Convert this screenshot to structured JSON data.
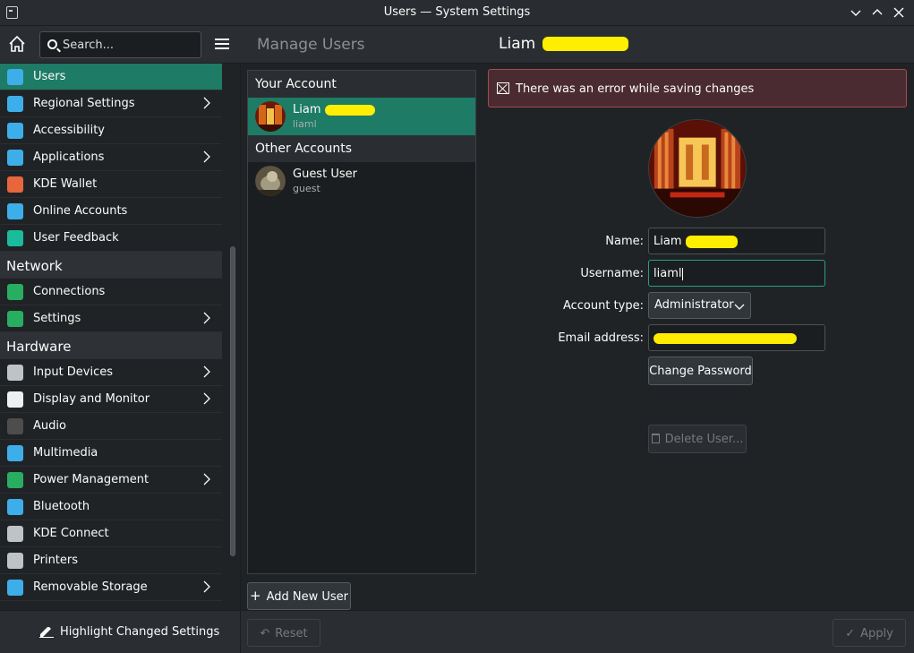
{
  "window": {
    "title": "Users — System Settings",
    "controls": [
      "chevron-down-icon",
      "chevron-up-icon",
      "close-icon"
    ]
  },
  "toolbar": {
    "search_placeholder": "Search...",
    "page_title": "Manage Users",
    "user_title": "Liam"
  },
  "sidebar": {
    "items": [
      {
        "label": "Users",
        "icon": "users-icon",
        "color": "#3daee9",
        "active": true,
        "chevron": false
      },
      {
        "label": "Regional Settings",
        "icon": "regional-settings-icon",
        "color": "#3daee9",
        "chevron": true
      },
      {
        "label": "Accessibility",
        "icon": "accessibility-icon",
        "color": "#3daee9",
        "chevron": false
      },
      {
        "label": "Applications",
        "icon": "applications-icon",
        "color": "#3daee9",
        "chevron": true
      },
      {
        "label": "KDE Wallet",
        "icon": "wallet-icon",
        "color": "#e8663c",
        "chevron": false
      },
      {
        "label": "Online Accounts",
        "icon": "online-accounts-icon",
        "color": "#3daee9",
        "chevron": false
      },
      {
        "label": "User Feedback",
        "icon": "feedback-icon",
        "color": "#1abc9c",
        "chevron": false
      }
    ],
    "network_header": "Network",
    "network_items": [
      {
        "label": "Connections",
        "icon": "globe-icon",
        "color": "#27ae60",
        "chevron": false
      },
      {
        "label": "Settings",
        "icon": "globe-icon",
        "color": "#27ae60",
        "chevron": true
      }
    ],
    "hardware_header": "Hardware",
    "hardware_items": [
      {
        "label": "Input Devices",
        "icon": "mouse-icon",
        "color": "#bdc3c7",
        "chevron": true
      },
      {
        "label": "Display and Monitor",
        "icon": "monitor-icon",
        "color": "#eff0f1",
        "chevron": true
      },
      {
        "label": "Audio",
        "icon": "speaker-icon",
        "color": "#4d4d4d",
        "chevron": false
      },
      {
        "label": "Multimedia",
        "icon": "multimedia-icon",
        "color": "#3daee9",
        "chevron": false
      },
      {
        "label": "Power Management",
        "icon": "power-icon",
        "color": "#27ae60",
        "chevron": true
      },
      {
        "label": "Bluetooth",
        "icon": "bluetooth-icon",
        "color": "#3daee9",
        "chevron": false
      },
      {
        "label": "KDE Connect",
        "icon": "phone-icon",
        "color": "#bdc3c7",
        "chevron": false
      },
      {
        "label": "Printers",
        "icon": "printer-icon",
        "color": "#bdc3c7",
        "chevron": false
      },
      {
        "label": "Removable Storage",
        "icon": "usb-icon",
        "color": "#3daee9",
        "chevron": true
      }
    ],
    "footer_button": "Highlight Changed Settings"
  },
  "accounts": {
    "your_account_header": "Your Account",
    "your_account": {
      "name": "Liam",
      "username": "liaml"
    },
    "other_accounts_header": "Other Accounts",
    "others": [
      {
        "name": "Guest User",
        "username": "guest"
      }
    ],
    "add_button": "Add New User",
    "reset_button": "Reset"
  },
  "detail": {
    "error_message": "There was an error while saving changes",
    "name_label": "Name:",
    "name_value": "Liam",
    "username_label": "Username:",
    "username_value": "liaml",
    "account_type_label": "Account type:",
    "account_type_value": "Administrator",
    "email_label": "Email address:",
    "change_password_button": "Change Password",
    "delete_user_button": "Delete User...",
    "apply_button": "Apply"
  }
}
